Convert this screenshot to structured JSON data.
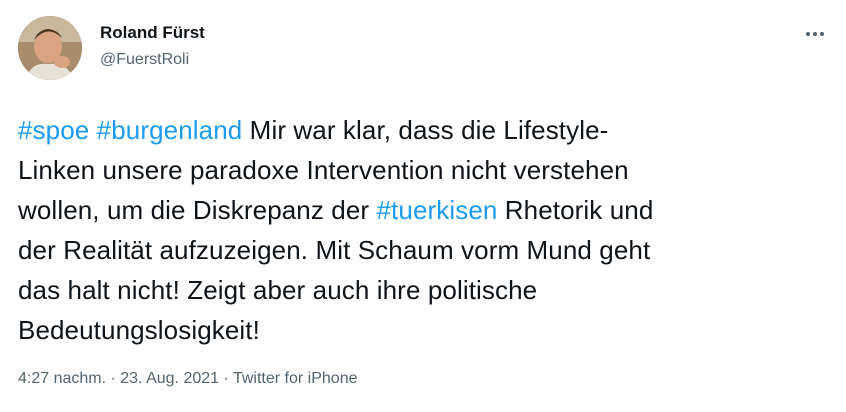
{
  "author": {
    "name": "Roland Fürst",
    "handle": "@FuerstRoli",
    "avatar_icon": "avatar-photo"
  },
  "more_icon": "more-dots-icon",
  "tweet": {
    "lines": [
      [
        {
          "text": "#spoe",
          "type": "hashtag"
        },
        {
          "text": " ",
          "type": "text"
        },
        {
          "text": "#burgenland",
          "type": "hashtag"
        },
        {
          "text": " Mir war klar, dass die Lifestyle-",
          "type": "text"
        }
      ],
      [
        {
          "text": "Linken unsere paradoxe Intervention nicht verstehen",
          "type": "text"
        }
      ],
      [
        {
          "text": "wollen, um die Diskrepanz der ",
          "type": "text"
        },
        {
          "text": "#tuerkisen",
          "type": "hashtag"
        },
        {
          "text": " Rhetorik und",
          "type": "text"
        }
      ],
      [
        {
          "text": "der Realität aufzuzeigen. Mit Schaum vorm Mund geht",
          "type": "text"
        }
      ],
      [
        {
          "text": "das halt nicht! Zeigt aber auch ihre politische",
          "type": "text"
        }
      ],
      [
        {
          "text": "Bedeutungslosigkeit!",
          "type": "text"
        }
      ]
    ]
  },
  "meta": {
    "time": "4:27 nachm.",
    "separator": " · ",
    "date": "23. Aug. 2021",
    "source": "Twitter for iPhone"
  },
  "colors": {
    "hashtag": "#1d9bf0",
    "text": "#0f1419",
    "secondary": "#536471"
  }
}
